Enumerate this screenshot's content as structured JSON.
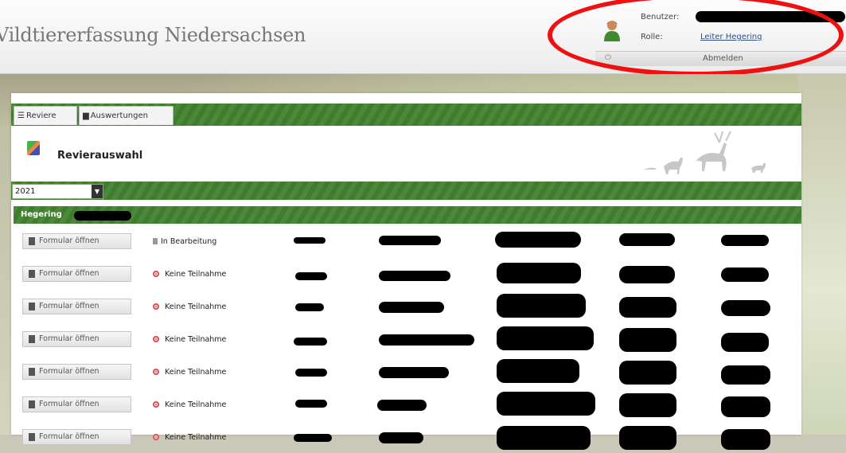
{
  "header": {
    "app_title": "Vildtiererfassung Niedersachsen",
    "user_label": "Benutzer:",
    "role_label": "Rolle:",
    "role_value": "Leiter Hegering",
    "logout_label": "Abmelden"
  },
  "tabs": [
    {
      "label": "Reviere",
      "icon": "list-icon"
    },
    {
      "label": "Auswertungen",
      "icon": "document-icon"
    }
  ],
  "page": {
    "title": "Revierauswahl",
    "title_icon": "map-icon",
    "year_selected": "2021",
    "group_label": "Hegering"
  },
  "rows": [
    {
      "button": "Formular öffnen",
      "status": "In Bearbeitung",
      "status_type": "in-progress"
    },
    {
      "button": "Formular öffnen",
      "status": "Keine Teilnahme",
      "status_type": "none"
    },
    {
      "button": "Formular öffnen",
      "status": "Keine Teilnahme",
      "status_type": "none"
    },
    {
      "button": "Formular öffnen",
      "status": "Keine Teilnahme",
      "status_type": "none"
    },
    {
      "button": "Formular öffnen",
      "status": "Keine Teilnahme",
      "status_type": "none"
    },
    {
      "button": "Formular öffnen",
      "status": "Keine Teilnahme",
      "status_type": "none"
    },
    {
      "button": "Formular öffnen",
      "status": "Keine Teilnahme",
      "status_type": "none"
    }
  ],
  "colors": {
    "accent_green": "#3e7d2c",
    "highlight_red": "#e11111",
    "status_red": "#e05050"
  }
}
